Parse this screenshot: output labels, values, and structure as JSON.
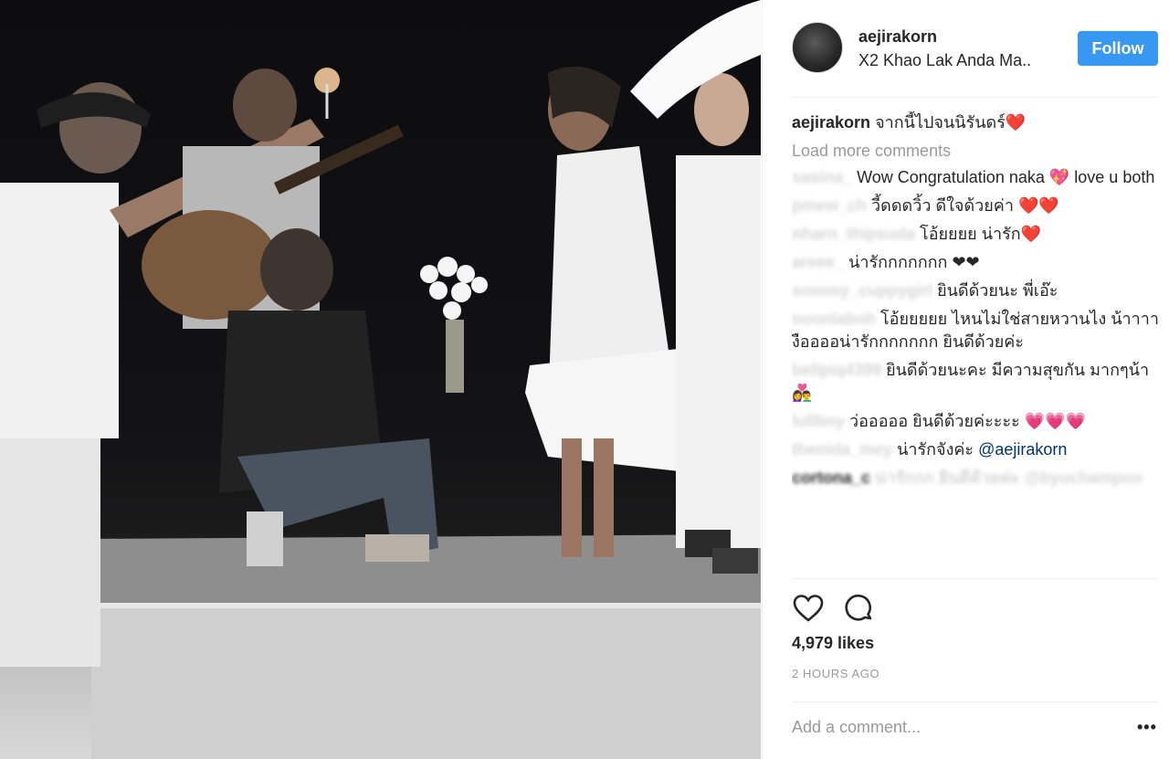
{
  "post": {
    "username": "aejirakorn",
    "location": "X2 Khao Lak Anda Ma..",
    "follow_label": "Follow",
    "caption_author": "aejirakorn",
    "caption_text": "จากนี้ไปจนนิรันดร์❤️"
  },
  "load_more_label": "Load more comments",
  "comments": [
    {
      "author": "sasina_",
      "text": "Wow Congratulation naka 💖 love u both"
    },
    {
      "author": "pmew_ch",
      "text": "วี้ดดดวิ้ว ดีใจด้วยค่า ❤️❤️"
    },
    {
      "author": "nharn_thipsuda",
      "text": "โอ้ยยยย น่ารัก❤️"
    },
    {
      "author": "areee_",
      "text": "น่ารักกกกกกก ❤❤"
    },
    {
      "author": "sommy_cuppygirl",
      "text": "ยินดีด้วยนะ พี่เอ๊ะ"
    },
    {
      "author": "noonlaboh",
      "text": "โอ้ยยยยย ไหนไม่ใช่สายหวานไง น้าาาา งืออออน่ารักกกกกกก ยินดีด้วยค่ะ"
    },
    {
      "author": "bellpiq4399",
      "text": "ยินดีด้วยนะคะ มีความสุขกัน มากๆน้า👩‍❤️‍👨"
    },
    {
      "author": "lullbny",
      "text": "ว่อออออ ยินดีด้วยค่ะะะะ 💗💗💗"
    },
    {
      "author": "thenida_mey",
      "text": "น่ารักจังค่ะ",
      "mention": "@aejirakorn"
    },
    {
      "author": "cortona_c",
      "text": "น่ารักกก ยินดีด้วยค่ะ @byuchampoo"
    }
  ],
  "actions": {
    "like_icon": "heart-icon",
    "comment_icon": "comment-icon"
  },
  "likes_label": "4,979 likes",
  "time_label": "2 HOURS AGO",
  "add_comment_placeholder": "Add a comment...",
  "more_options_label": "•••",
  "colors": {
    "follow_button": "#3897f0",
    "secondary_text": "#999999",
    "mention": "#003569"
  }
}
